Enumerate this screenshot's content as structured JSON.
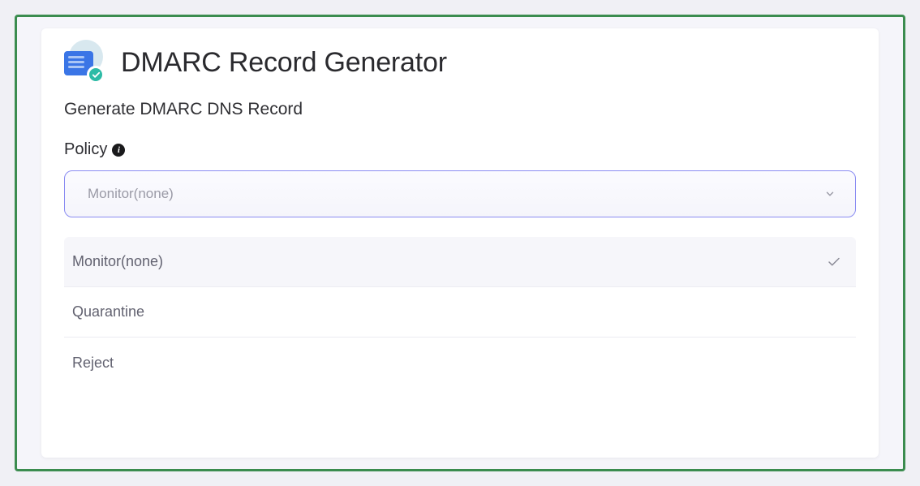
{
  "header": {
    "title": "DMARC Record Generator"
  },
  "subtitle": "Generate DMARC DNS Record",
  "policy": {
    "label": "Policy",
    "selected_value": "Monitor(none)",
    "options": [
      {
        "label": "Monitor(none)",
        "selected": true
      },
      {
        "label": "Quarantine",
        "selected": false
      },
      {
        "label": "Reject",
        "selected": false
      }
    ]
  },
  "colors": {
    "frame_border": "#3b8c4f",
    "select_border": "#8a8cf2",
    "accent_teal": "#2dbba6",
    "icon_blue": "#3a75e6"
  }
}
